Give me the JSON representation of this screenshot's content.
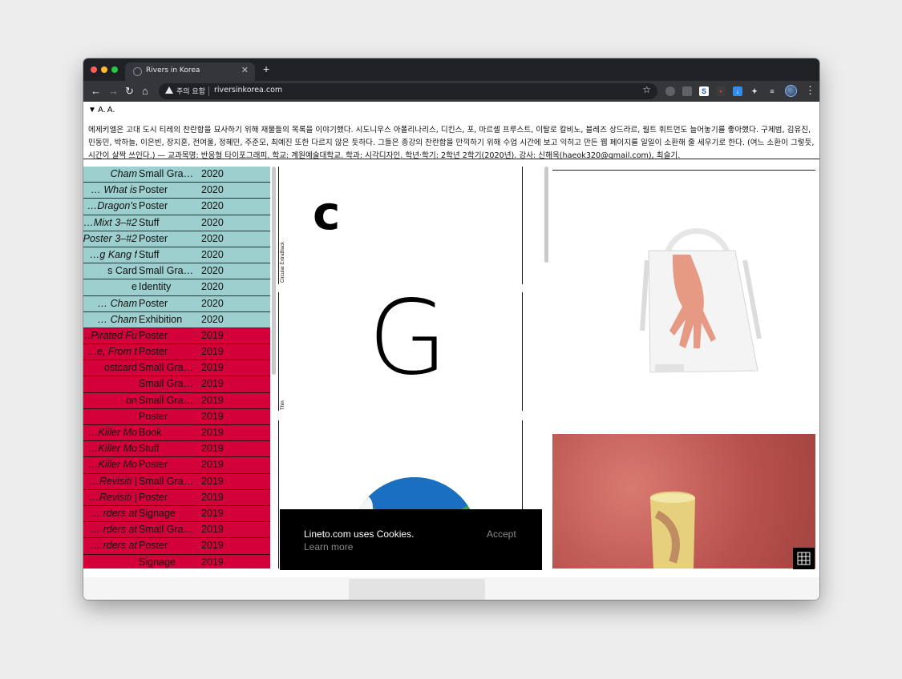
{
  "browser": {
    "tab_title": "Rivers in Korea",
    "tab_close": "✕",
    "new_tab": "+",
    "security_label": "주의 요함",
    "url": "riversinkorea.com"
  },
  "page": {
    "font_controls": "▼ A. A.",
    "intro": "에제키엘은 고대 도시 티레의 찬란함을 묘사하기 위해 재물들의 목록을 이야기했다. 시도니우스 아폴리나리스, 디킨스, 포, 마르셀 프루스트, 이탈로 칼비노, 블레즈 상드라르, 월트 휘트먼도 늘어놓기를 좋아했다. 구제범, 김유진, 민동민, 박하늘, 이은빈, 장지훈, 전여울, 정혜민, 주준모, 최예진 또한 다르지 않은 듯하다. 그들은 종강의 찬란함을 만끽하기 위해 수업 시간에 보고 익히고 만든 웹 페이지를 일일이 소환해 줄 세우기로 한다. (여느 소환이 그렇듯, 시간이 살짝 쓰인다.) — 교과목명: 반응형 타이포그래피. 학교: 계원예술대학교. 학과: 시각디자인. 학년·학기: 2학년 2학기(2020년). 강사: 신해옥(haeok320@gmail.com), 최슬기."
  },
  "list": {
    "rows": [
      {
        "title": "Cham",
        "type": "Small Gra…",
        "year": "2020",
        "color": "teal",
        "italic": true
      },
      {
        "title": "What is …",
        "type": "Poster",
        "year": "2020",
        "color": "teal",
        "italic": true
      },
      {
        "title": "Dragon's…",
        "type": "Poster",
        "year": "2020",
        "color": "teal",
        "italic": true
      },
      {
        "title": "#2–3 Mixt…",
        "type": "Stuff",
        "year": "2020",
        "color": "teal",
        "italic": true
      },
      {
        "title": "#2–3 Poster",
        "type": "Poster",
        "year": "2020",
        "color": "teal",
        "italic": true
      },
      {
        "title": "g Kang f…",
        "type": "Stuff",
        "year": "2020",
        "color": "teal",
        "italic": true
      },
      {
        "title": "s Card",
        "type": "Small Gra…",
        "year": "2020",
        "color": "teal",
        "italic": false
      },
      {
        "title": "e",
        "type": "Identity",
        "year": "2020",
        "color": "teal",
        "italic": false
      },
      {
        "title": "Cham …",
        "type": "Poster",
        "year": "2020",
        "color": "teal",
        "italic": true
      },
      {
        "title": "Cham …",
        "type": "Exhibition",
        "year": "2020",
        "color": "teal",
        "italic": true
      },
      {
        "title": "Pirated Fu…",
        "type": "Poster",
        "year": "2019",
        "color": "red",
        "italic": true
      },
      {
        "title": "e, From t…",
        "type": "Poster",
        "year": "2019",
        "color": "red",
        "italic": true
      },
      {
        "title": "ostcard",
        "type": "Small Gra…",
        "year": "2019",
        "color": "red",
        "italic": false
      },
      {
        "title": "",
        "type": "Small Gra…",
        "year": "2019",
        "color": "red",
        "italic": false
      },
      {
        "title": "on",
        "type": "Small Gra…",
        "year": "2019",
        "color": "red",
        "italic": false
      },
      {
        "title": "",
        "type": "Poster",
        "year": "2019",
        "color": "red",
        "italic": false
      },
      {
        "title": "Killer Mo…",
        "type": "Book",
        "year": "2019",
        "color": "red",
        "italic": true
      },
      {
        "title": "Killer Mo…",
        "type": "Stuff",
        "year": "2019",
        "color": "red",
        "italic": true
      },
      {
        "title": "Killer Mo…",
        "type": "Poster",
        "year": "2019",
        "color": "red",
        "italic": true
      },
      {
        "title": "| Revisiti…",
        "type": "Small Gra…",
        "year": "2019",
        "color": "red",
        "italic": true
      },
      {
        "title": "| Revisiti…",
        "type": "Poster",
        "year": "2019",
        "color": "red",
        "italic": true
      },
      {
        "title": "rders at …",
        "type": "Signage",
        "year": "2019",
        "color": "red",
        "italic": true
      },
      {
        "title": "rders at …",
        "type": "Small Gra…",
        "year": "2019",
        "color": "red",
        "italic": true
      },
      {
        "title": "rders at …",
        "type": "Poster",
        "year": "2019",
        "color": "red",
        "italic": true
      },
      {
        "title": "",
        "type": "Signage",
        "year": "2019",
        "color": "red",
        "italic": false
      }
    ]
  },
  "specimen": {
    "label_1": "Circular ExtraBlack",
    "glyph_1": "c",
    "label_2": "Thin",
    "glyph_2": "G"
  },
  "cookie": {
    "message": "Lineto.com uses Cookies.",
    "learn_more": "Learn more",
    "accept": "Accept"
  },
  "colors": {
    "teal": "#9ccfce",
    "red": "#d4003a",
    "chrome_dark": "#202124",
    "chrome_toolbar": "#35363a"
  }
}
